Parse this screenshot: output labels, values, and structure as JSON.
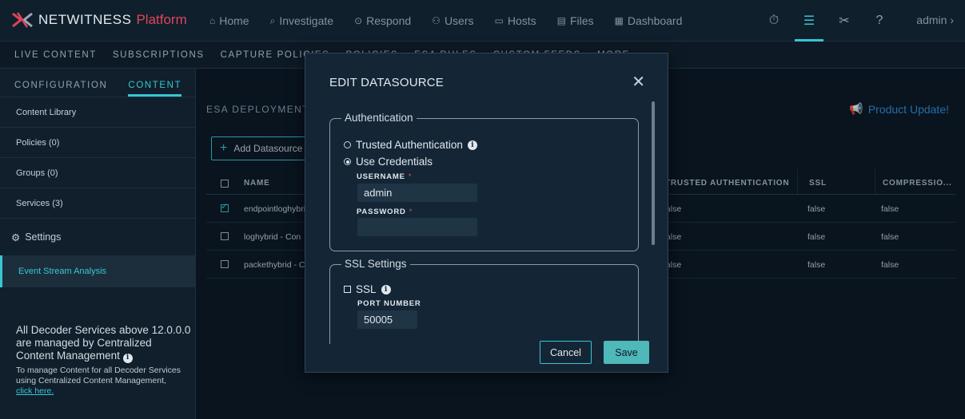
{
  "app": {
    "brand": "NETWITNESS",
    "platform": "Platform"
  },
  "nav": [
    {
      "icon": "⌂",
      "label": "Home",
      "name": "nav-home"
    },
    {
      "icon": "⌕",
      "label": "Investigate",
      "name": "nav-investigate"
    },
    {
      "icon": "⊙",
      "label": "Respond",
      "name": "nav-respond"
    },
    {
      "icon": "⚇",
      "label": "Users",
      "name": "nav-users"
    },
    {
      "icon": "▭",
      "label": "Hosts",
      "name": "nav-hosts"
    },
    {
      "icon": "▤",
      "label": "Files",
      "name": "nav-files"
    },
    {
      "icon": "▦",
      "label": "Dashboard",
      "name": "nav-dashboard"
    }
  ],
  "tools": {
    "timer": "⏱",
    "admin_panel": "☰",
    "config": "✂",
    "help": "?"
  },
  "user": {
    "label": "admin",
    "chevron": "›"
  },
  "subnav": [
    "LIVE CONTENT",
    "SUBSCRIPTIONS",
    "CAPTURE POLICIES",
    "POLICIES",
    "ESA RULES",
    "CUSTOM FEEDS",
    "MORE..."
  ],
  "sidebar": {
    "tabs": [
      "CONFIGURATION",
      "CONTENT"
    ],
    "items": [
      "Content Library",
      "Policies (0)",
      "Groups (0)",
      "Services (3)"
    ],
    "settings_label": "Settings",
    "active_item": "Event Stream Analysis",
    "notice_title": "All Decoder Services above 12.0.0.0 are managed by Centralized Content Management",
    "notice_text": "To manage Content for all Decoder Services using Centralized Content Management,",
    "notice_link": "click here."
  },
  "main": {
    "title": "ESA DEPLOYMENT",
    "product_update": "Product Update!",
    "add_button": "Add Datasource",
    "columns": [
      "NAME",
      "TRUSTED AUTHENTICATION",
      "SSL",
      "COMPRESSIO..."
    ],
    "rows": [
      {
        "name": "endpointloghybrid",
        "trusted": "false",
        "ssl": "false",
        "compression": "false",
        "checked": true
      },
      {
        "name": "loghybrid - Con",
        "trusted": "false",
        "ssl": "false",
        "compression": "false",
        "checked": false
      },
      {
        "name": "packethybrid - C",
        "trusted": "false",
        "ssl": "false",
        "compression": "false",
        "checked": false
      }
    ]
  },
  "modal": {
    "title": "EDIT DATASOURCE",
    "auth_legend": "Authentication",
    "trusted_auth": "Trusted Authentication",
    "use_credentials": "Use Credentials",
    "selected_auth": "use_credentials",
    "username_label": "USERNAME",
    "username_value": "admin",
    "password_label": "PASSWORD",
    "password_value": "",
    "ssl_legend": "SSL Settings",
    "ssl_label": "SSL",
    "ssl_checked": false,
    "port_label": "PORT NUMBER",
    "port_value": "50005",
    "cancel": "Cancel",
    "save": "Save"
  },
  "colors": {
    "accent": "#38c6d4",
    "brand_red": "#e0455a",
    "link_blue": "#2f8fd9",
    "save_bg": "#4fb8b9"
  }
}
